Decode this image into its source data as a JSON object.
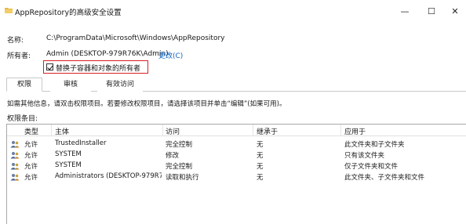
{
  "window": {
    "title": "AppRepository的高级安全设置",
    "minimize_glyph": "—",
    "maximize_glyph": "☐",
    "close_glyph": "✕"
  },
  "name": {
    "label": "名称:",
    "value": "C:\\ProgramData\\Microsoft\\Windows\\AppRepository"
  },
  "owner": {
    "label": "所有者:",
    "value": "Admin (DESKTOP-979R76K\\Admin)",
    "change_link": "更改(C)"
  },
  "replace_owner_checkbox": {
    "label": "替换子容器和对象的所有者",
    "checked": true
  },
  "tabs": [
    {
      "label": "权限",
      "active": true
    },
    {
      "label": "审核",
      "active": false
    },
    {
      "label": "有效访问",
      "active": false
    }
  ],
  "instructions": "如需其他信息，请双击权限项目。若要修改权限项目，请选择该项目并单击“编辑”(如果可用)。",
  "permission_entries_label": "权限条目:",
  "table": {
    "headers": [
      "类型",
      "主体",
      "访问",
      "继承于",
      "应用于"
    ],
    "rows": [
      {
        "type": "允许",
        "principal": "TrustedInstaller",
        "access": "完全控制",
        "inherited": "无",
        "applies_to": "此文件夹和子文件夹"
      },
      {
        "type": "允许",
        "principal": "SYSTEM",
        "access": "修改",
        "inherited": "无",
        "applies_to": "只有该文件夹"
      },
      {
        "type": "允许",
        "principal": "SYSTEM",
        "access": "完全控制",
        "inherited": "无",
        "applies_to": "仅子文件夹和文件"
      },
      {
        "type": "允许",
        "principal": "Administrators (DESKTOP-979R7...",
        "access": "读取和执行",
        "inherited": "无",
        "applies_to": "此文件夹、子文件夹和文件"
      }
    ]
  },
  "colors": {
    "link": "#0a63c9",
    "highlight_border": "#d82020",
    "folder": "#e8b84a"
  },
  "icons": [
    "folder-icon",
    "minimize-icon",
    "maximize-icon",
    "close-icon",
    "user-group-icon"
  ]
}
